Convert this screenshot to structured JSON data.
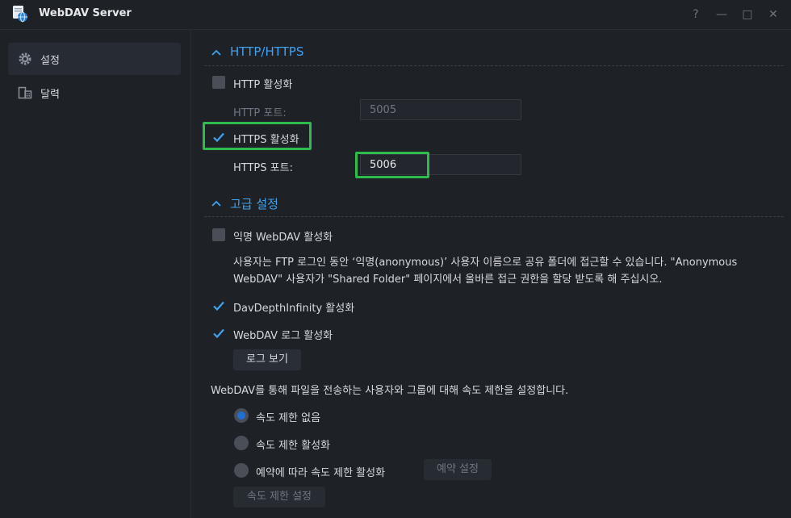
{
  "window": {
    "title": "WebDAV Server",
    "help_label": "?",
    "minimize_label": "—",
    "maximize_label": "□",
    "close_label": "✕"
  },
  "sidebar": {
    "items": [
      {
        "label": "설정",
        "icon": "gear-icon",
        "active": true
      },
      {
        "label": "달력",
        "icon": "calendar-icon",
        "active": false
      }
    ]
  },
  "http_section": {
    "title": "HTTP/HTTPS",
    "http_enable": {
      "label": "HTTP 활성화",
      "checked": false
    },
    "http_port": {
      "label": "HTTP 포트:",
      "value": "5005"
    },
    "https_enable": {
      "label": "HTTPS 활성화",
      "checked": true
    },
    "https_port": {
      "label": "HTTPS 포트:",
      "value": "5006"
    }
  },
  "advanced_section": {
    "title": "고급 설정",
    "anonymous": {
      "label": "익명 WebDAV 활성화",
      "checked": false,
      "description": "사용자는 FTP 로그인 동안 ‘익명(anonymous)’ 사용자 이름으로 공유 폴더에 접근할 수 있습니다. \"Anonymous WebDAV\" 사용자가 \"Shared Folder\" 페이지에서 올바른 접근 권한을 할당 받도록 해 주십시오."
    },
    "depth_infinity": {
      "label": "DavDepthInfinity 활성화",
      "checked": true
    },
    "log_enable": {
      "label": "WebDAV 로그 활성화",
      "checked": true
    },
    "view_log_button": "로그 보기",
    "speed_intro": "WebDAV를 통해 파일을 전송하는 사용자와 그룹에 대해 속도 제한을 설정합니다.",
    "speed_options": [
      {
        "label": "속도 제한 없음",
        "selected": true
      },
      {
        "label": "속도 제한 활성화",
        "selected": false
      },
      {
        "label": "예약에 따라 속도 제한 활성화",
        "selected": false
      }
    ],
    "schedule_button": "예약 설정",
    "speed_settings_button": "속도 제한 설정"
  },
  "colors": {
    "accent": "#3fa3f0",
    "highlight": "#2ebd4c",
    "background": "#1e2126"
  }
}
